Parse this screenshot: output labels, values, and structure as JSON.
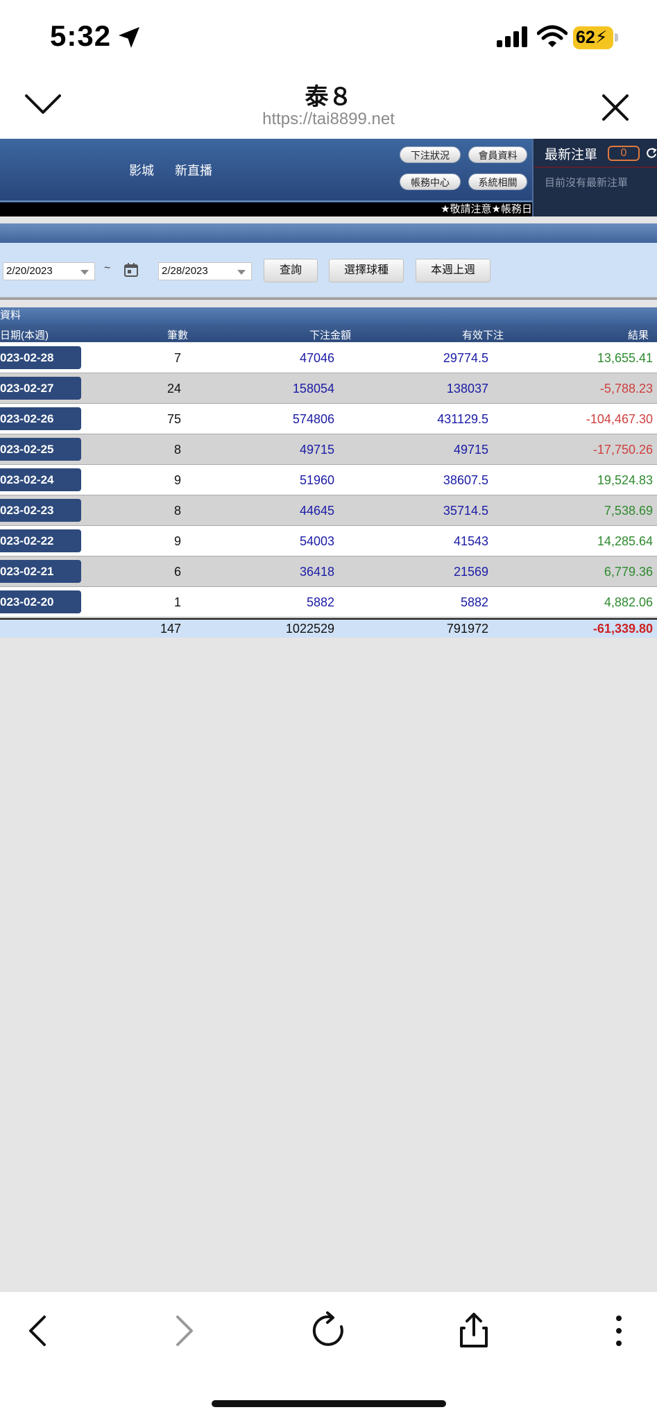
{
  "status_bar": {
    "time": "5:32",
    "battery": "62"
  },
  "browser": {
    "title": "泰８",
    "url": "https://tai8899.net"
  },
  "site_nav": {
    "links": [
      "影城",
      "新直播"
    ]
  },
  "header_buttons": [
    "下注狀況",
    "會員資料",
    "帳務中心",
    "系統相關"
  ],
  "ticker": "★敬請注意★帳務日",
  "side_panel": {
    "title": "最新注單",
    "badge": "0",
    "empty_text": "目前沒有最新注單"
  },
  "filter": {
    "start_date": "2/20/2023",
    "tilde": "~",
    "end_date": "2/28/2023",
    "buttons": [
      "查詢",
      "選擇球種",
      "本週上週"
    ]
  },
  "table": {
    "caption": "資料",
    "headers": [
      "日期(本週)",
      "筆數",
      "下注金額",
      "有效下注",
      "結果"
    ],
    "rows": [
      {
        "date": "023-02-28",
        "count": "7",
        "amount": "47046",
        "valid": "29774.5",
        "result": "13,655.41",
        "sign": "pos"
      },
      {
        "date": "023-02-27",
        "count": "24",
        "amount": "158054",
        "valid": "138037",
        "result": "-5,788.23",
        "sign": "neg"
      },
      {
        "date": "023-02-26",
        "count": "75",
        "amount": "574806",
        "valid": "431129.5",
        "result": "-104,467.30",
        "sign": "neg"
      },
      {
        "date": "023-02-25",
        "count": "8",
        "amount": "49715",
        "valid": "49715",
        "result": "-17,750.26",
        "sign": "neg"
      },
      {
        "date": "023-02-24",
        "count": "9",
        "amount": "51960",
        "valid": "38607.5",
        "result": "19,524.83",
        "sign": "pos"
      },
      {
        "date": "023-02-23",
        "count": "8",
        "amount": "44645",
        "valid": "35714.5",
        "result": "7,538.69",
        "sign": "pos"
      },
      {
        "date": "023-02-22",
        "count": "9",
        "amount": "54003",
        "valid": "41543",
        "result": "14,285.64",
        "sign": "pos"
      },
      {
        "date": "023-02-21",
        "count": "6",
        "amount": "36418",
        "valid": "21569",
        "result": "6,779.36",
        "sign": "pos"
      },
      {
        "date": "023-02-20",
        "count": "1",
        "amount": "5882",
        "valid": "5882",
        "result": "4,882.06",
        "sign": "pos"
      }
    ],
    "total": {
      "count": "147",
      "amount": "1022529",
      "valid": "791972",
      "result": "-61,339.80"
    }
  },
  "colors": {
    "positive": "#2e8a2e",
    "negative": "#d04040",
    "header_blue": "#2c4a7d",
    "total_negative": "#cc2222"
  },
  "icons": [
    "location-arrow-icon",
    "signal-icon",
    "wifi-icon",
    "chevron-down-icon",
    "close-icon",
    "refresh-icon",
    "calendar-icon",
    "back-icon",
    "forward-icon",
    "reload-icon",
    "share-icon",
    "more-icon"
  ]
}
